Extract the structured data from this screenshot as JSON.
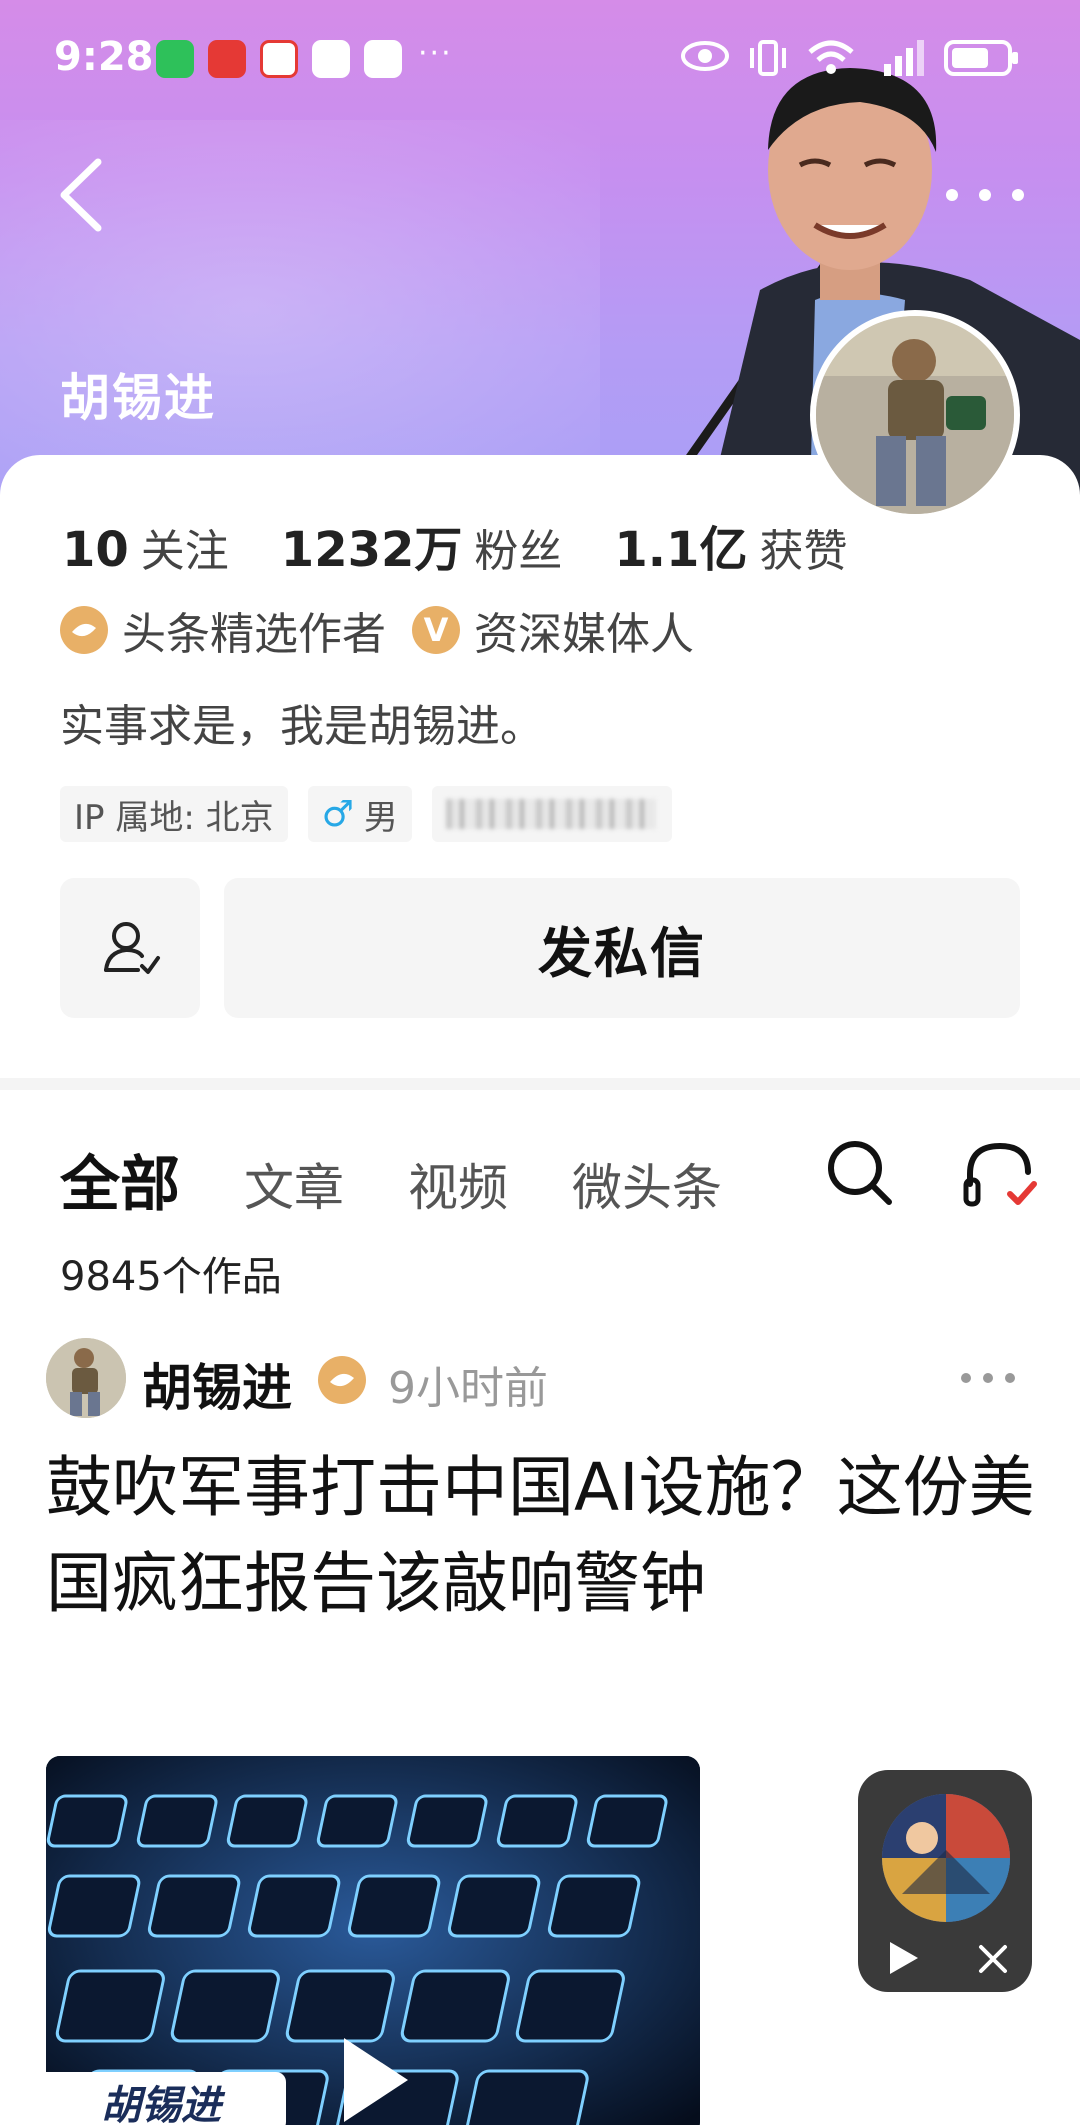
{
  "statusbar": {
    "time": "9:28",
    "more": "···"
  },
  "header": {
    "profile_name": "胡锡进"
  },
  "stats": [
    {
      "value": "10",
      "label": "关注"
    },
    {
      "value": "1232万",
      "label": "粉丝"
    },
    {
      "value": "1.1亿",
      "label": "获赞"
    }
  ],
  "badges": [
    {
      "icon": "toutiao-badge-icon",
      "label": "头条精选作者"
    },
    {
      "icon": "v-badge-icon",
      "glyph": "V",
      "label": "资深媒体人"
    }
  ],
  "bio": "实事求是，我是胡锡进。",
  "tags": {
    "ip": "IP 属地: 北京",
    "gender_icon": "♂",
    "gender": "男"
  },
  "actions": {
    "message": "发私信"
  },
  "tabs": [
    {
      "label": "全部",
      "active": true
    },
    {
      "label": "文章"
    },
    {
      "label": "视频"
    },
    {
      "label": "微头条"
    }
  ],
  "works_count": "9845个作品",
  "post": {
    "author": "胡锡进",
    "time": "9小时前",
    "title": "鼓吹军事打击中国AI设施？这份美国疯狂报告该敲响警钟",
    "thumbnail_label": "胡锡进"
  },
  "colors": {
    "accent_gold": "#e8b067",
    "banner_top": "#d58ce8",
    "banner_bottom": "#a99ff6"
  }
}
